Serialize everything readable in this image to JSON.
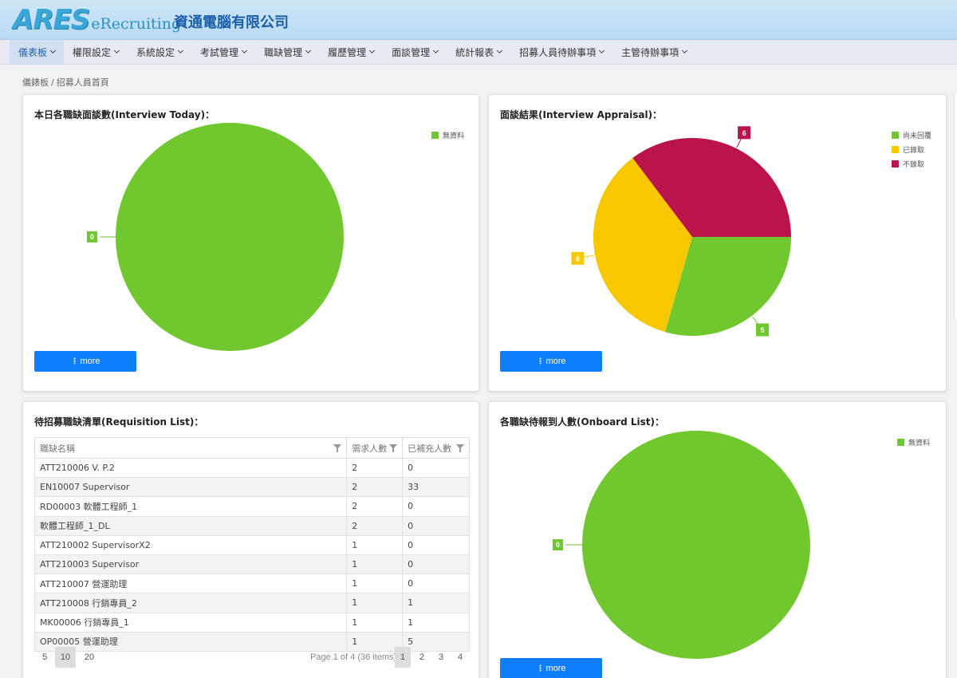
{
  "header": {
    "logo_ares": "ARES",
    "logo_product": "eRecruiting",
    "company": "資通電腦有限公司"
  },
  "nav": [
    {
      "label": "儀表板",
      "active": true
    },
    {
      "label": "權限設定"
    },
    {
      "label": "系統設定"
    },
    {
      "label": "考試管理"
    },
    {
      "label": "職缺管理"
    },
    {
      "label": "履歷管理"
    },
    {
      "label": "面談管理"
    },
    {
      "label": "統計報表"
    },
    {
      "label": "招募人員待辦事項"
    },
    {
      "label": "主管待辦事項"
    }
  ],
  "breadcrumb": {
    "root": "儀錶板",
    "current": "招募人員首頁"
  },
  "colors": {
    "green": "#70c72e",
    "yellow": "#f7c800",
    "crimson": "#bb144b",
    "button": "#0d7efc"
  },
  "cards": {
    "interview_today": {
      "title": "本日各職缺面談數(Interview Today)：",
      "more": "more",
      "legend": [
        "無資料"
      ],
      "chart_data": {
        "type": "pie",
        "categories": [
          "無資料"
        ],
        "values": [
          0
        ],
        "labels": [
          "0"
        ]
      }
    },
    "interview_appraisal": {
      "title": "面談結果(Interview Appraisal)：",
      "more": "more",
      "legend": [
        "尚未回覆",
        "已錄取",
        "不錄取"
      ],
      "chart_data": {
        "type": "pie",
        "categories": [
          "尚未回覆",
          "已錄取",
          "不錄取"
        ],
        "values": [
          5,
          6,
          6
        ],
        "labels": [
          "5",
          "6",
          "6"
        ]
      }
    },
    "requisition": {
      "title": "待招募職缺清單(Requisition List)：",
      "columns": [
        "職缺名稱",
        "需求人數",
        "已補充人數"
      ],
      "rows": [
        [
          "ATT210006 V. P.2",
          "2",
          "0"
        ],
        [
          "EN10007 Supervisor",
          "2",
          "33"
        ],
        [
          "RD00003 軟體工程師_1",
          "2",
          "0"
        ],
        [
          "軟體工程師_1_DL",
          "2",
          "0"
        ],
        [
          "ATT210002 SupervisorX2",
          "1",
          "0"
        ],
        [
          "ATT210003 Supervisor",
          "1",
          "0"
        ],
        [
          "ATT210007 營運助理",
          "1",
          "0"
        ],
        [
          "ATT210008 行銷專員_2",
          "1",
          "1"
        ],
        [
          "MK00006 行銷專員_1",
          "1",
          "1"
        ],
        [
          "OP00005 營運助理",
          "1",
          "5"
        ]
      ],
      "pager": {
        "sizes": [
          "5",
          "10",
          "20"
        ],
        "info": "Page 1 of 4 (36 items)",
        "pages": [
          "1",
          "2",
          "3",
          "4"
        ]
      }
    },
    "onboard": {
      "title": "各職缺待報到人數(Onboard List)：",
      "more": "more",
      "legend": [
        "無資料"
      ],
      "chart_data": {
        "type": "pie",
        "categories": [
          "無資料"
        ],
        "values": [
          0
        ],
        "labels": [
          "0"
        ]
      }
    }
  }
}
